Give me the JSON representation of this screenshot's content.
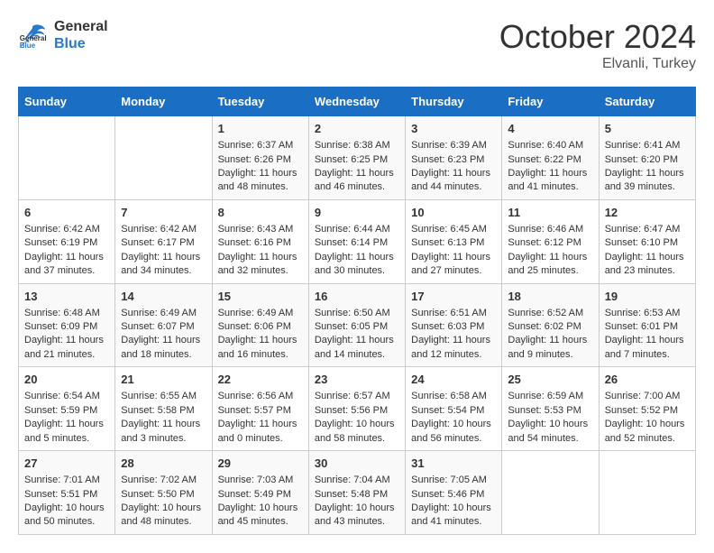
{
  "header": {
    "logo_line1": "General",
    "logo_line2": "Blue",
    "month_title": "October 2024",
    "location": "Elvanli, Turkey"
  },
  "days_of_week": [
    "Sunday",
    "Monday",
    "Tuesday",
    "Wednesday",
    "Thursday",
    "Friday",
    "Saturday"
  ],
  "weeks": [
    [
      {
        "day": "",
        "sunrise": "",
        "sunset": "",
        "daylight": ""
      },
      {
        "day": "",
        "sunrise": "",
        "sunset": "",
        "daylight": ""
      },
      {
        "day": "1",
        "sunrise": "Sunrise: 6:37 AM",
        "sunset": "Sunset: 6:26 PM",
        "daylight": "Daylight: 11 hours and 48 minutes."
      },
      {
        "day": "2",
        "sunrise": "Sunrise: 6:38 AM",
        "sunset": "Sunset: 6:25 PM",
        "daylight": "Daylight: 11 hours and 46 minutes."
      },
      {
        "day": "3",
        "sunrise": "Sunrise: 6:39 AM",
        "sunset": "Sunset: 6:23 PM",
        "daylight": "Daylight: 11 hours and 44 minutes."
      },
      {
        "day": "4",
        "sunrise": "Sunrise: 6:40 AM",
        "sunset": "Sunset: 6:22 PM",
        "daylight": "Daylight: 11 hours and 41 minutes."
      },
      {
        "day": "5",
        "sunrise": "Sunrise: 6:41 AM",
        "sunset": "Sunset: 6:20 PM",
        "daylight": "Daylight: 11 hours and 39 minutes."
      }
    ],
    [
      {
        "day": "6",
        "sunrise": "Sunrise: 6:42 AM",
        "sunset": "Sunset: 6:19 PM",
        "daylight": "Daylight: 11 hours and 37 minutes."
      },
      {
        "day": "7",
        "sunrise": "Sunrise: 6:42 AM",
        "sunset": "Sunset: 6:17 PM",
        "daylight": "Daylight: 11 hours and 34 minutes."
      },
      {
        "day": "8",
        "sunrise": "Sunrise: 6:43 AM",
        "sunset": "Sunset: 6:16 PM",
        "daylight": "Daylight: 11 hours and 32 minutes."
      },
      {
        "day": "9",
        "sunrise": "Sunrise: 6:44 AM",
        "sunset": "Sunset: 6:14 PM",
        "daylight": "Daylight: 11 hours and 30 minutes."
      },
      {
        "day": "10",
        "sunrise": "Sunrise: 6:45 AM",
        "sunset": "Sunset: 6:13 PM",
        "daylight": "Daylight: 11 hours and 27 minutes."
      },
      {
        "day": "11",
        "sunrise": "Sunrise: 6:46 AM",
        "sunset": "Sunset: 6:12 PM",
        "daylight": "Daylight: 11 hours and 25 minutes."
      },
      {
        "day": "12",
        "sunrise": "Sunrise: 6:47 AM",
        "sunset": "Sunset: 6:10 PM",
        "daylight": "Daylight: 11 hours and 23 minutes."
      }
    ],
    [
      {
        "day": "13",
        "sunrise": "Sunrise: 6:48 AM",
        "sunset": "Sunset: 6:09 PM",
        "daylight": "Daylight: 11 hours and 21 minutes."
      },
      {
        "day": "14",
        "sunrise": "Sunrise: 6:49 AM",
        "sunset": "Sunset: 6:07 PM",
        "daylight": "Daylight: 11 hours and 18 minutes."
      },
      {
        "day": "15",
        "sunrise": "Sunrise: 6:49 AM",
        "sunset": "Sunset: 6:06 PM",
        "daylight": "Daylight: 11 hours and 16 minutes."
      },
      {
        "day": "16",
        "sunrise": "Sunrise: 6:50 AM",
        "sunset": "Sunset: 6:05 PM",
        "daylight": "Daylight: 11 hours and 14 minutes."
      },
      {
        "day": "17",
        "sunrise": "Sunrise: 6:51 AM",
        "sunset": "Sunset: 6:03 PM",
        "daylight": "Daylight: 11 hours and 12 minutes."
      },
      {
        "day": "18",
        "sunrise": "Sunrise: 6:52 AM",
        "sunset": "Sunset: 6:02 PM",
        "daylight": "Daylight: 11 hours and 9 minutes."
      },
      {
        "day": "19",
        "sunrise": "Sunrise: 6:53 AM",
        "sunset": "Sunset: 6:01 PM",
        "daylight": "Daylight: 11 hours and 7 minutes."
      }
    ],
    [
      {
        "day": "20",
        "sunrise": "Sunrise: 6:54 AM",
        "sunset": "Sunset: 5:59 PM",
        "daylight": "Daylight: 11 hours and 5 minutes."
      },
      {
        "day": "21",
        "sunrise": "Sunrise: 6:55 AM",
        "sunset": "Sunset: 5:58 PM",
        "daylight": "Daylight: 11 hours and 3 minutes."
      },
      {
        "day": "22",
        "sunrise": "Sunrise: 6:56 AM",
        "sunset": "Sunset: 5:57 PM",
        "daylight": "Daylight: 11 hours and 0 minutes."
      },
      {
        "day": "23",
        "sunrise": "Sunrise: 6:57 AM",
        "sunset": "Sunset: 5:56 PM",
        "daylight": "Daylight: 10 hours and 58 minutes."
      },
      {
        "day": "24",
        "sunrise": "Sunrise: 6:58 AM",
        "sunset": "Sunset: 5:54 PM",
        "daylight": "Daylight: 10 hours and 56 minutes."
      },
      {
        "day": "25",
        "sunrise": "Sunrise: 6:59 AM",
        "sunset": "Sunset: 5:53 PM",
        "daylight": "Daylight: 10 hours and 54 minutes."
      },
      {
        "day": "26",
        "sunrise": "Sunrise: 7:00 AM",
        "sunset": "Sunset: 5:52 PM",
        "daylight": "Daylight: 10 hours and 52 minutes."
      }
    ],
    [
      {
        "day": "27",
        "sunrise": "Sunrise: 7:01 AM",
        "sunset": "Sunset: 5:51 PM",
        "daylight": "Daylight: 10 hours and 50 minutes."
      },
      {
        "day": "28",
        "sunrise": "Sunrise: 7:02 AM",
        "sunset": "Sunset: 5:50 PM",
        "daylight": "Daylight: 10 hours and 48 minutes."
      },
      {
        "day": "29",
        "sunrise": "Sunrise: 7:03 AM",
        "sunset": "Sunset: 5:49 PM",
        "daylight": "Daylight: 10 hours and 45 minutes."
      },
      {
        "day": "30",
        "sunrise": "Sunrise: 7:04 AM",
        "sunset": "Sunset: 5:48 PM",
        "daylight": "Daylight: 10 hours and 43 minutes."
      },
      {
        "day": "31",
        "sunrise": "Sunrise: 7:05 AM",
        "sunset": "Sunset: 5:46 PM",
        "daylight": "Daylight: 10 hours and 41 minutes."
      },
      {
        "day": "",
        "sunrise": "",
        "sunset": "",
        "daylight": ""
      },
      {
        "day": "",
        "sunrise": "",
        "sunset": "",
        "daylight": ""
      }
    ]
  ]
}
